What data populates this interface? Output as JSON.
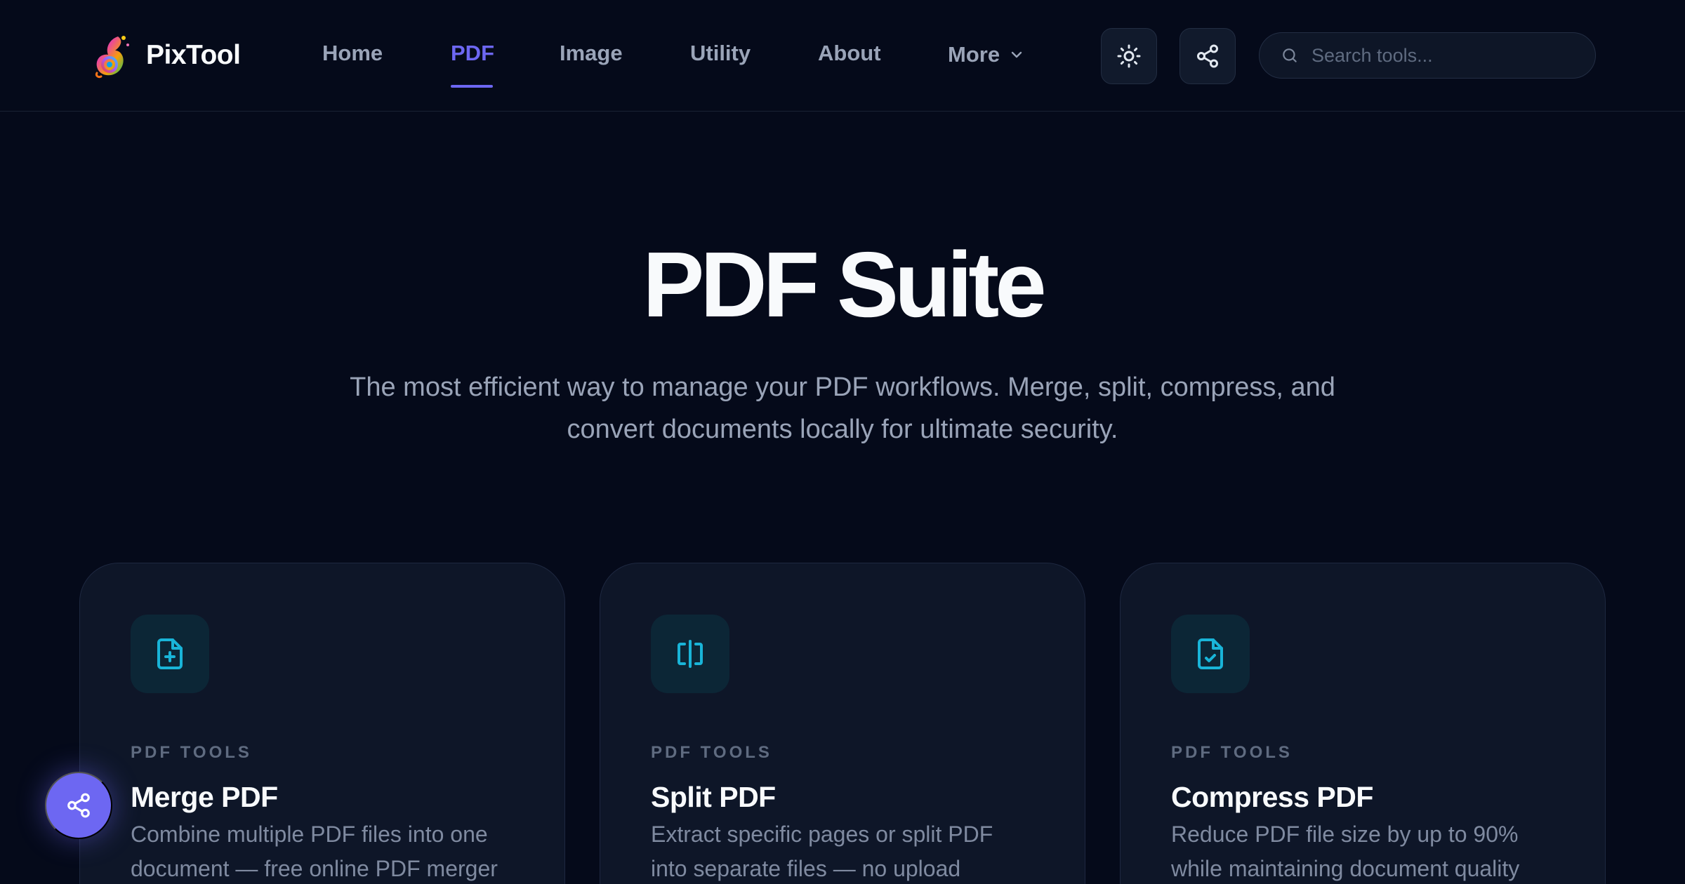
{
  "header": {
    "brand": {
      "name": "PixTool",
      "logo_icon": "rainbow-swirl-logo"
    },
    "nav": {
      "home": "Home",
      "pdf": "PDF",
      "image": "Image",
      "utility": "Utility",
      "about": "About",
      "more": "More",
      "active": "PDF"
    },
    "theme_toggle_icon": "sun-icon",
    "share_icon": "share-icon",
    "search": {
      "placeholder": "Search tools...",
      "value": ""
    }
  },
  "hero": {
    "title": "PDF Suite",
    "subtitle_line1": "The most efficient way to manage your PDF workflows. Merge, split, compress, and",
    "subtitle_line2": "convert documents locally for ultimate security."
  },
  "cards": [
    {
      "icon": "file-plus-icon",
      "eyebrow": "PDF TOOLS",
      "title": "Merge PDF",
      "desc_line1": "Combine multiple PDF files into one",
      "desc_line2": "document — free online PDF merger"
    },
    {
      "icon": "split-columns-icon",
      "eyebrow": "PDF TOOLS",
      "title": "Split PDF",
      "desc_line1": "Extract specific pages or split PDF",
      "desc_line2": "into separate files — no upload"
    },
    {
      "icon": "file-check-icon",
      "eyebrow": "PDF TOOLS",
      "title": "Compress PDF",
      "desc_line1": "Reduce PDF file size by up to 90%",
      "desc_line2": "while maintaining document quality"
    }
  ],
  "floating_share_icon": "share-icon",
  "colors": {
    "background": "#050a1a",
    "accent": "#6d67f2",
    "card_icon": "#19b4d8",
    "card_bg": "#0e1628"
  }
}
